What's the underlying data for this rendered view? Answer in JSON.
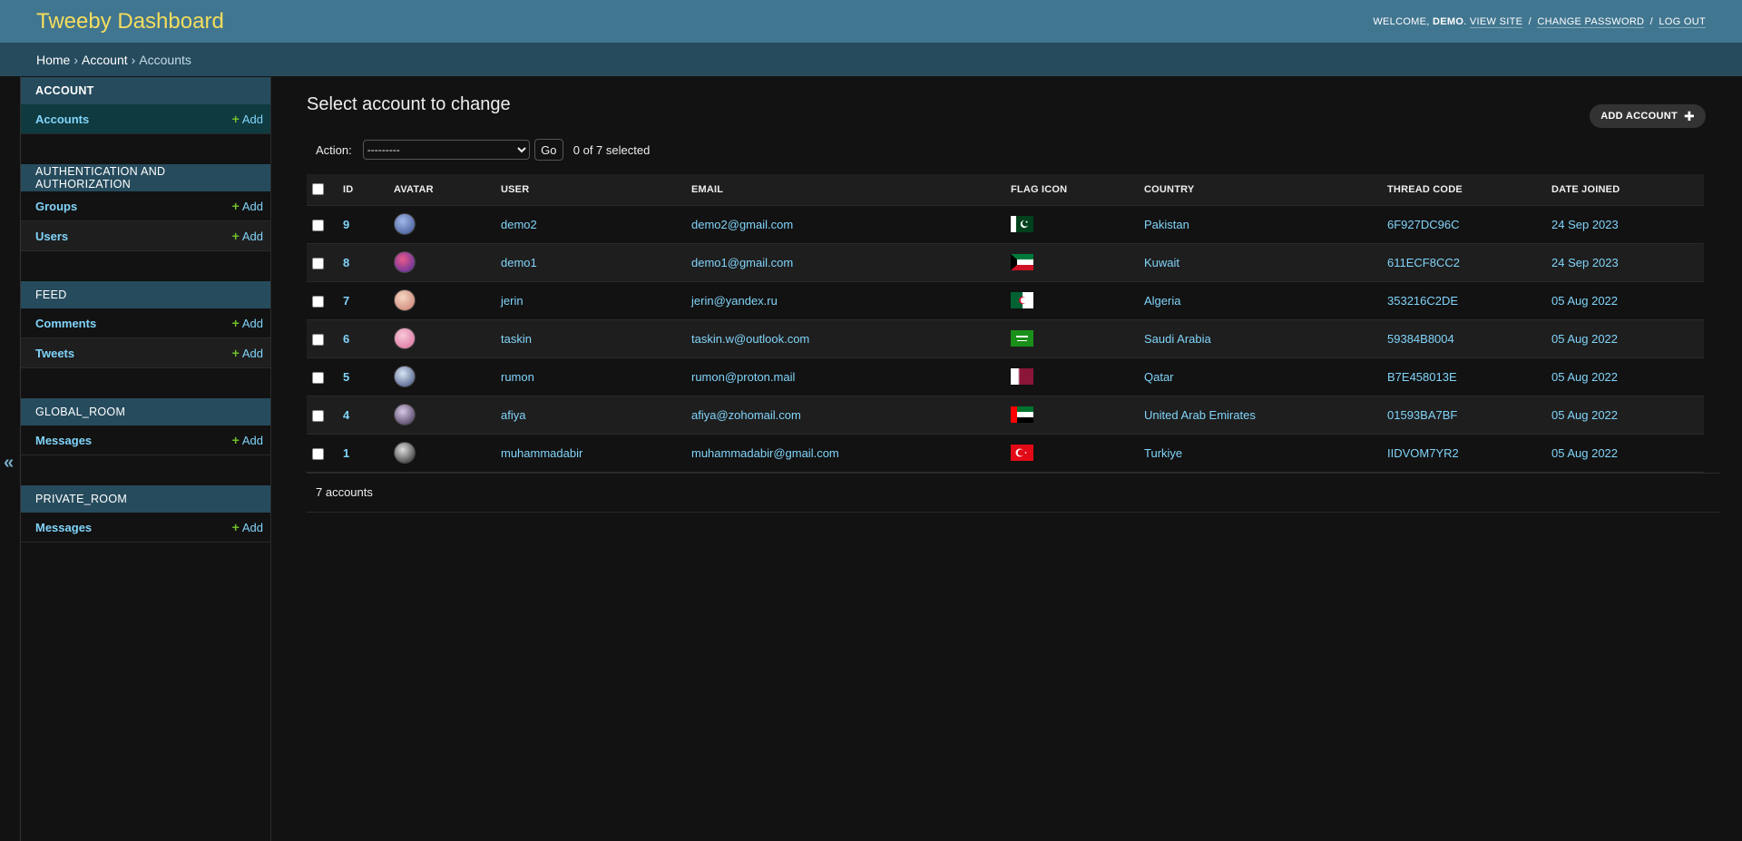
{
  "header": {
    "site_name": "Tweeby Dashboard",
    "welcome": "WELCOME,",
    "username": "DEMO",
    "view_site": "VIEW SITE",
    "change_password": "CHANGE PASSWORD",
    "log_out": "LOG OUT",
    "sep": "/"
  },
  "breadcrumbs": {
    "home": "Home",
    "app": "Account",
    "current": "Accounts",
    "sep": "›"
  },
  "sidebar": {
    "toggle_glyph": "«",
    "add_label": "Add",
    "modules": [
      {
        "caption": "ACCOUNT",
        "models": [
          {
            "name": "Accounts"
          }
        ]
      },
      {
        "caption": "AUTHENTICATION AND AUTHORIZATION",
        "models": [
          {
            "name": "Groups"
          },
          {
            "name": "Users"
          }
        ]
      },
      {
        "caption": "FEED",
        "models": [
          {
            "name": "Comments"
          },
          {
            "name": "Tweets"
          }
        ]
      },
      {
        "caption": "GLOBAL_ROOM",
        "models": [
          {
            "name": "Messages"
          }
        ]
      },
      {
        "caption": "PRIVATE_ROOM",
        "models": [
          {
            "name": "Messages"
          }
        ]
      }
    ]
  },
  "content": {
    "title": "Select account to change",
    "add_button": "ADD ACCOUNT",
    "action_label": "Action:",
    "action_selected": "---------",
    "go_label": "Go",
    "selection_count": "0 of 7 selected",
    "columns": [
      "ID",
      "AVATAR",
      "USER",
      "EMAIL",
      "FLAG ICON",
      "COUNTRY",
      "THREAD CODE",
      "DATE JOINED"
    ],
    "rows": [
      {
        "id": "9",
        "user": "demo2",
        "email": "demo2@gmail.com",
        "flag": "pakistan-flag-icon",
        "country": "Pakistan",
        "thread": "6F927DC96C",
        "date": "24 Sep 2023"
      },
      {
        "id": "8",
        "user": "demo1",
        "email": "demo1@gmail.com",
        "flag": "kuwait-flag-icon",
        "country": "Kuwait",
        "thread": "611ECF8CC2",
        "date": "24 Sep 2023"
      },
      {
        "id": "7",
        "user": "jerin",
        "email": "jerin@yandex.ru",
        "flag": "algeria-flag-icon",
        "country": "Algeria",
        "thread": "353216C2DE",
        "date": "05 Aug 2022"
      },
      {
        "id": "6",
        "user": "taskin",
        "email": "taskin.w@outlook.com",
        "flag": "saudi-arabia-flag-icon",
        "country": "Saudi Arabia",
        "thread": "59384B8004",
        "date": "05 Aug 2022"
      },
      {
        "id": "5",
        "user": "rumon",
        "email": "rumon@proton.mail",
        "flag": "qatar-flag-icon",
        "country": "Qatar",
        "thread": "B7E458013E",
        "date": "05 Aug 2022"
      },
      {
        "id": "4",
        "user": "afiya",
        "email": "afiya@zohomail.com",
        "flag": "uae-flag-icon",
        "country": "United Arab Emirates",
        "thread": "01593BA7BF",
        "date": "05 Aug 2022"
      },
      {
        "id": "1",
        "user": "muhammadabir",
        "email": "muhammadabir@gmail.com",
        "flag": "turkiye-flag-icon",
        "country": "Turkiye",
        "thread": "IIDVOM7YR2",
        "date": "05 Aug 2022"
      }
    ],
    "result_count": "7 accounts"
  },
  "colors": {
    "header_bg": "#417690",
    "breadcrumb_bg": "#264b5d",
    "site_name": "#f5dd5d",
    "link": "#81d4fa",
    "add_plus": "#70bf2b",
    "page_bg": "#121212"
  }
}
